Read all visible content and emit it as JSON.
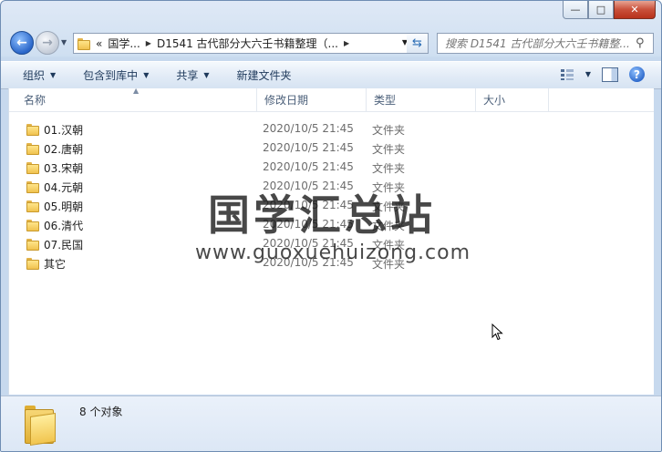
{
  "window": {
    "caption": {
      "minimize": "—",
      "maximize": "□",
      "close": "✕"
    }
  },
  "nav": {
    "back_icon": "back-arrow-icon",
    "forward_icon": "forward-arrow-icon",
    "address": {
      "overflow": "«",
      "segments": [
        "国学...",
        "D1541 古代部分大六壬书籍整理（..."
      ]
    },
    "search_placeholder": "搜索 D1541 古代部分大六壬书籍整..."
  },
  "toolbar": {
    "organize": "组织",
    "include_in_library": "包含到库中",
    "share": "共享",
    "new_folder": "新建文件夹"
  },
  "columns": {
    "name": "名称",
    "date": "修改日期",
    "type": "类型",
    "size": "大小"
  },
  "files": [
    {
      "name": "01.汉朝",
      "date": "2020/10/5 21:45",
      "type": "文件夹"
    },
    {
      "name": "02.唐朝",
      "date": "2020/10/5 21:45",
      "type": "文件夹"
    },
    {
      "name": "03.宋朝",
      "date": "2020/10/5 21:45",
      "type": "文件夹"
    },
    {
      "name": "04.元朝",
      "date": "2020/10/5 21:45",
      "type": "文件夹"
    },
    {
      "name": "05.明朝",
      "date": "2020/10/5 21:45",
      "type": "文件夹"
    },
    {
      "name": "06.清代",
      "date": "2020/10/5 21:45",
      "type": "文件夹"
    },
    {
      "name": "07.民国",
      "date": "2020/10/5 21:45",
      "type": "文件夹"
    },
    {
      "name": "其它",
      "date": "2020/10/5 21:45",
      "type": "文件夹"
    }
  ],
  "status": {
    "count_text": "8 个对象"
  },
  "watermark": {
    "title": "国学汇总站",
    "url": "www.guoxuehuizong.com"
  }
}
